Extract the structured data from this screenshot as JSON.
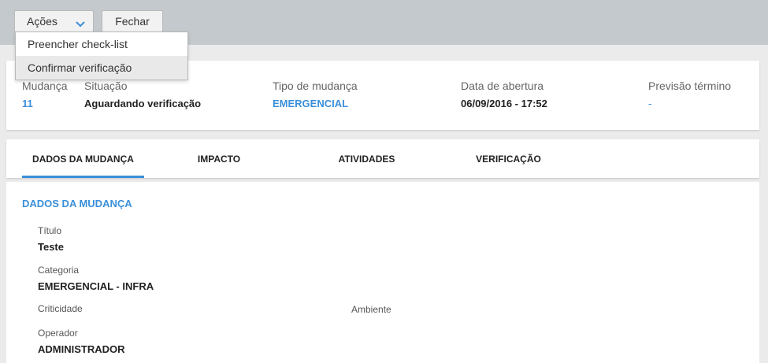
{
  "toolbar": {
    "actions_label": "Ações",
    "close_label": "Fechar"
  },
  "actions_menu": {
    "items": [
      "Preencher check-list",
      "Confirmar verificação"
    ]
  },
  "summary": {
    "change": {
      "label": "Mudança",
      "value": "11"
    },
    "status": {
      "label": "Situação",
      "value": "Aguardando verificação"
    },
    "type": {
      "label": "Tipo de mudança",
      "value": "EMERGENCIAL"
    },
    "opened": {
      "label": "Data de abertura",
      "value": "06/09/2016 - 17:52"
    },
    "forecast": {
      "label": "Previsão término",
      "value": "-"
    }
  },
  "tabs": [
    "DADOS DA MUDANÇA",
    "IMPACTO",
    "ATIVIDADES",
    "VERIFICAÇÃO"
  ],
  "details": {
    "section_title": "DADOS DA MUDANÇA",
    "title": {
      "label": "Título",
      "value": "Teste"
    },
    "category": {
      "label": "Categoria",
      "value": "EMERGENCIAL - INFRA"
    },
    "criticality": {
      "label": "Criticidade",
      "value": ""
    },
    "environment": {
      "label": "Ambiente",
      "value": ""
    },
    "operator": {
      "label": "Operador",
      "value": "ADMINISTRADOR"
    }
  },
  "colors": {
    "accent": "#3a8fd9",
    "toolbar": "#c3c9cc"
  }
}
